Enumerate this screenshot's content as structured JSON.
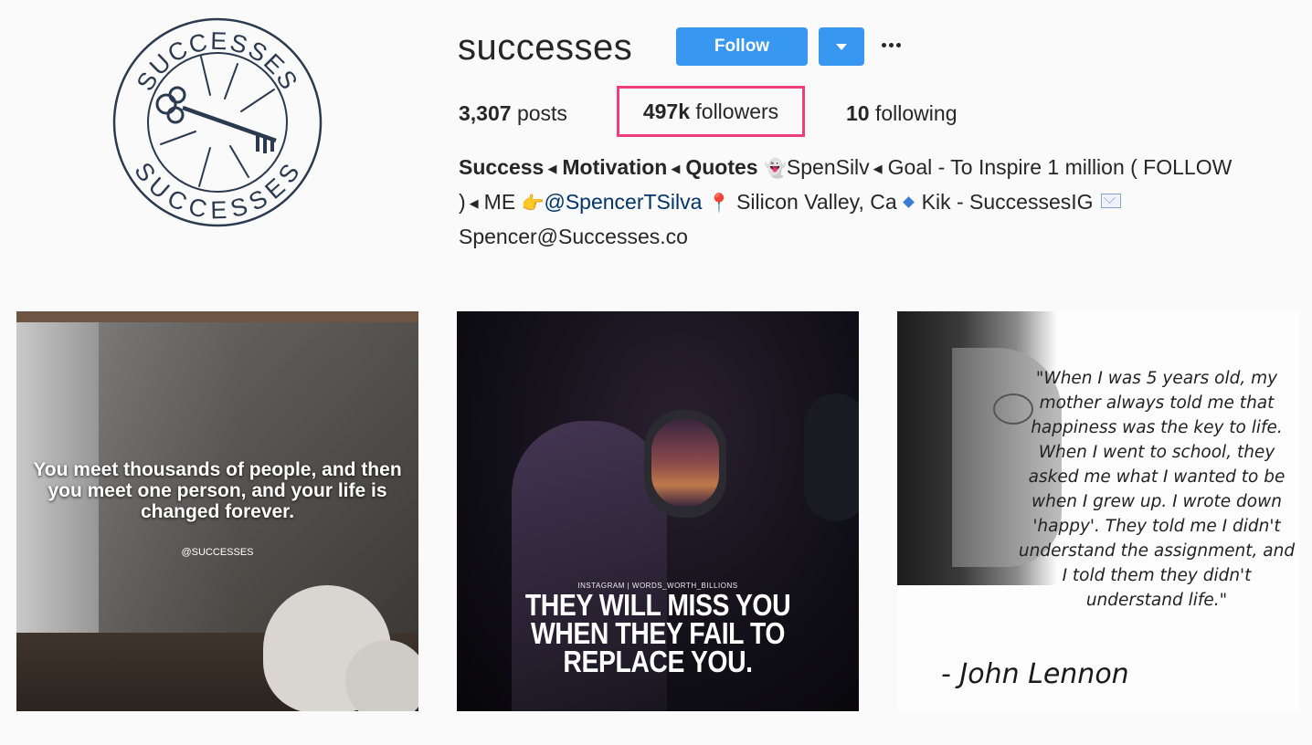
{
  "profile": {
    "username": "successes",
    "follow_label": "Follow",
    "avatar_text_top": "SUCCESSES",
    "avatar_text_bottom": "SUCCESSES"
  },
  "stats": {
    "posts_count": "3,307",
    "posts_label": "posts",
    "followers_count": "497k",
    "followers_label": "followers",
    "following_count": "10",
    "following_label": "following",
    "highlight_color": "#ef3e7c"
  },
  "bio": {
    "tag1": "Success",
    "tag2": "Motivation",
    "tag3": "Quotes",
    "snap": "SpenSilv",
    "goal": "Goal - To Inspire 1 million ( FOLLOW )",
    "me": "ME",
    "mention": "@SpencerTSilva",
    "location": "Silicon Valley, Ca",
    "kik": "Kik - SuccessesIG",
    "email": "Spencer@Successes.co"
  },
  "posts": [
    {
      "caption": "You meet thousands of people, and then you meet one person, and your life is changed forever.",
      "watermark": "@SUCCESSES"
    },
    {
      "tag": "INSTAGRAM | WORDS_WORTH_BILLIONS",
      "caption": "THEY WILL MISS YOU WHEN THEY FAIL TO REPLACE YOU."
    },
    {
      "quote": "\"When I was 5 years old, my mother always told me that happiness was the key to life. When I went to school, they asked me what I wanted to be when I grew up. I wrote down 'happy'. They told me I didn't understand the assignment, and I told them they didn't understand life.\"",
      "author": "- John Lennon"
    }
  ],
  "colors": {
    "accent": "#3897f0",
    "text": "#262626",
    "mention": "#003569",
    "logo": "#2b3a4f"
  }
}
